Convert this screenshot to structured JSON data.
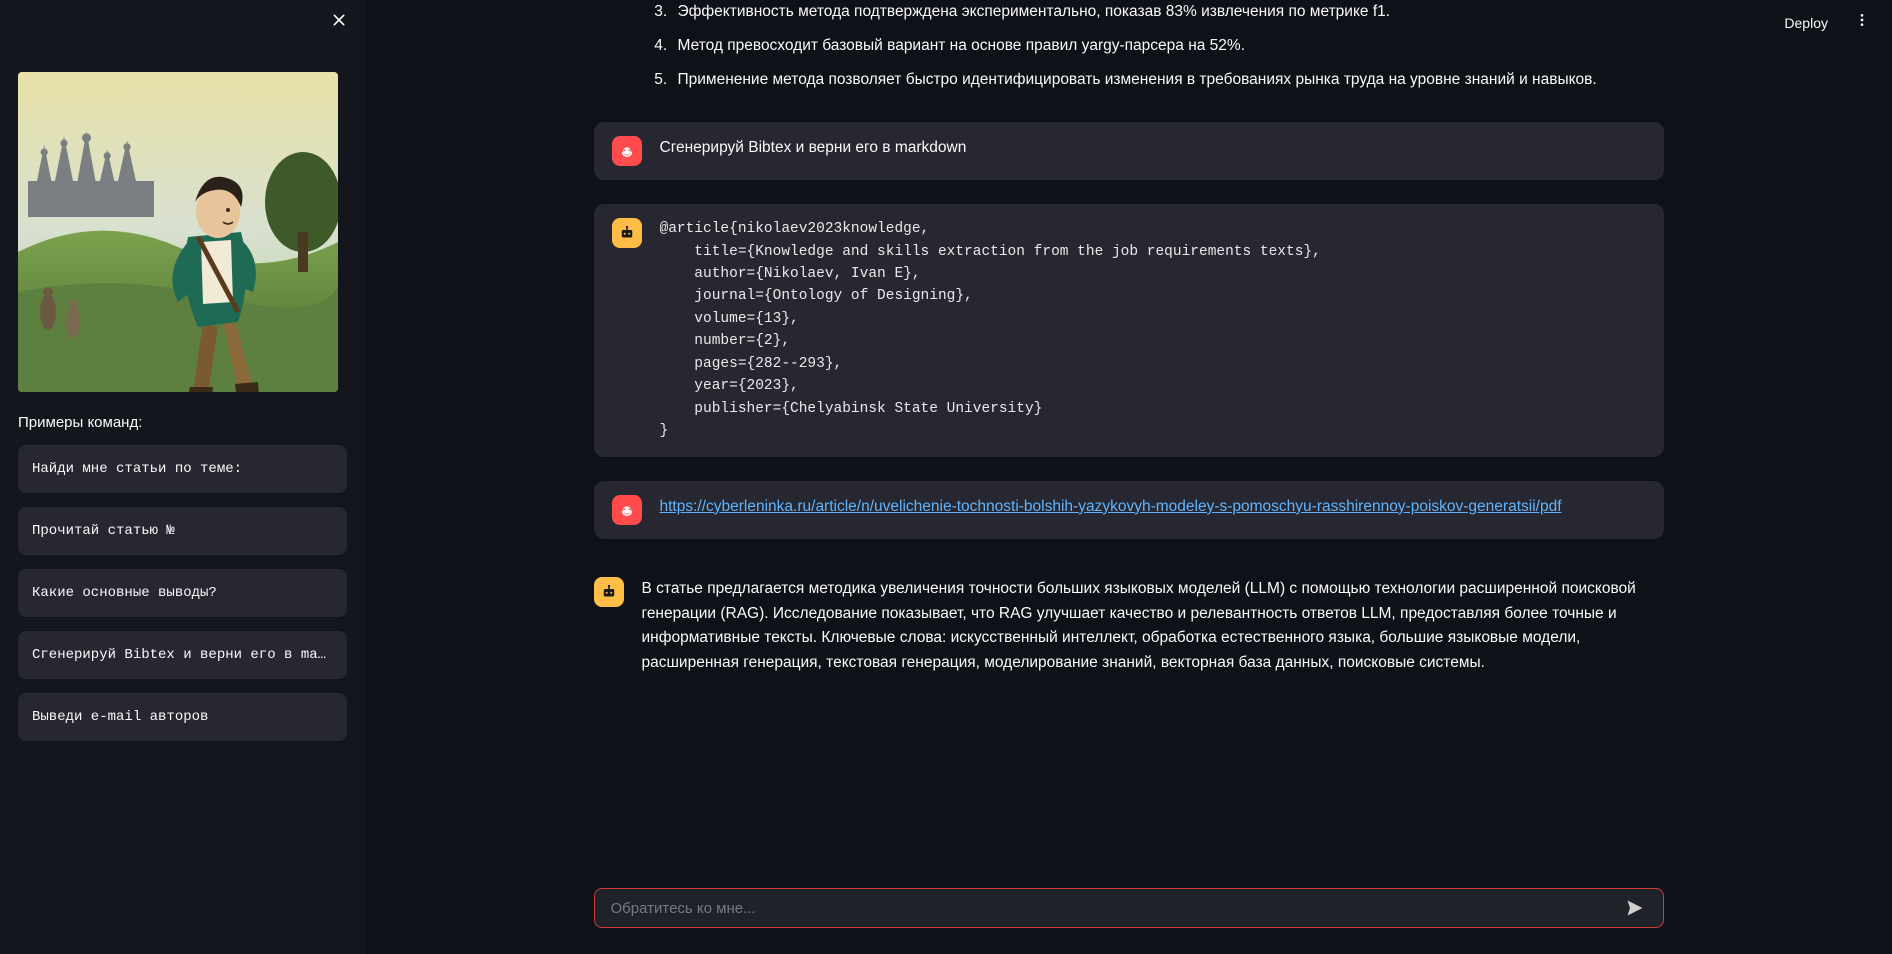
{
  "topbar": {
    "deploy_label": "Deploy"
  },
  "sidebar": {
    "heading": "Примеры команд:",
    "commands": [
      "Найди мне статьи по теме:",
      "Прочитай статью №",
      "Какие основные выводы?",
      "Сгенерируй Bibtex и верни его в markdown",
      "Выведи e-mail авторов"
    ]
  },
  "chat": {
    "ordered_points": {
      "start": 3,
      "items": [
        "Эффективность метода подтверждена экспериментально, показав 83% извлечения по метрике f1.",
        "Метод превосходит базовый вариант на основе правил yargy-парсера на 52%.",
        "Применение метода позволяет быстро идентифицировать изменения в требованиях рынка труда на уровне знаний и навыков."
      ]
    },
    "user_prompt_1": "Сгенерируй Bibtex и верни его в markdown",
    "bot_code": "@article{nikolaev2023knowledge,\n    title={Knowledge and skills extraction from the job requirements texts},\n    author={Nikolaev, Ivan E},\n    journal={Ontology of Designing},\n    volume={13},\n    number={2},\n    pages={282--293},\n    year={2023},\n    publisher={Chelyabinsk State University}\n}",
    "user_link_text": "https://cyberleninka.ru/article/n/uvelichenie-tochnosti-bolshih-yazykovyh-modeley-s-pomoschyu-rasshirennoy-poiskov-generatsii/pdf",
    "bot_summary": "В статье предлагается методика увеличения точности больших языковых моделей (LLM) с помощью технологии расширенной поисковой генерации (RAG). Исследование показывает, что RAG улучшает качество и релевантность ответов LLM, предоставляя более точные и информативные тексты. Ключевые слова: искусственный интеллект, обработка естественного языка, большие языковые модели, расширенная генерация, текстовая генерация, моделирование знаний, векторная база данных, поисковые системы."
  },
  "input": {
    "placeholder": "Обратитесь ко мне..."
  }
}
